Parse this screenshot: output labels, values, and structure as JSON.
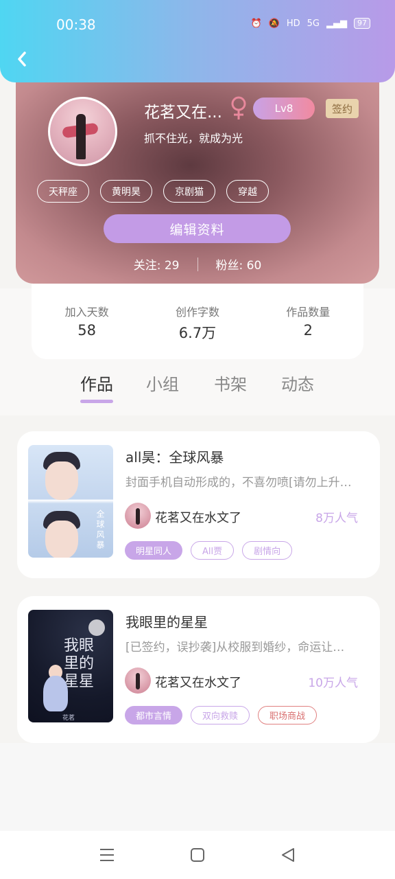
{
  "status_bar": {
    "time": "00:38",
    "hd": "HD",
    "network": "5G",
    "battery": "97"
  },
  "profile": {
    "name": "花茗又在...",
    "level": "Lv8",
    "sign_badge": "签约",
    "motto": "抓不住光，就成为光",
    "tags": [
      "天秤座",
      "黄明昊",
      "京剧猫",
      "穿越"
    ],
    "edit_button": "编辑资料",
    "following": "关注: 29",
    "followers": "粉丝: 60"
  },
  "stats": [
    {
      "label": "加入天数",
      "value": "58"
    },
    {
      "label": "创作字数",
      "value": "6.7万"
    },
    {
      "label": "作品数量",
      "value": "2"
    }
  ],
  "tabs": [
    "作品",
    "小组",
    "书架",
    "动态"
  ],
  "active_tab": "作品",
  "books": [
    {
      "title": "all昊：全球风暴",
      "desc": "封面手机自动形成的，不喜勿喷[请勿上升…",
      "author": "花茗又在水文了",
      "popularity": "8万人气",
      "tags": [
        "明星同人",
        "All贾",
        "剧情向"
      ],
      "cover_text": "全球风暴"
    },
    {
      "title": "我眼里的星星",
      "desc": "[已签约，误抄袭]从校服到婚纱，命运让…",
      "author": "花茗又在水文了",
      "popularity": "10万人气",
      "tags": [
        "都市言情",
        "双向救赎",
        "职场商战"
      ],
      "cover_title": "我眼里的星星",
      "cover_author": "花茗"
    }
  ],
  "colors": {
    "accent": "#c8a6e8",
    "header_start": "#4fd6f2",
    "header_end": "#b89ae8",
    "tag_red": "#e08080"
  }
}
